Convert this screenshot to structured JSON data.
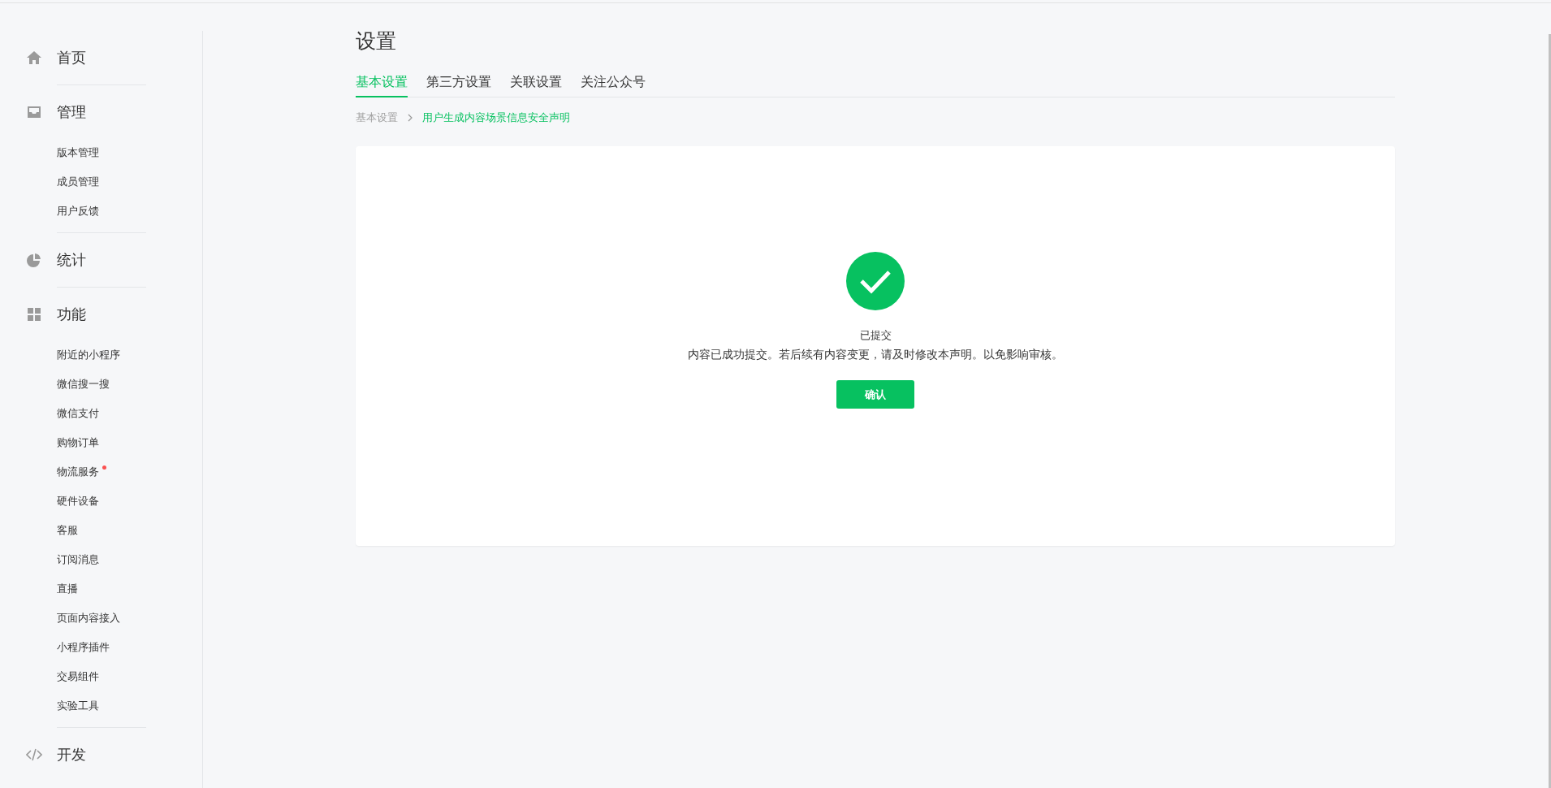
{
  "sidebar": {
    "groups": [
      {
        "label": "首页"
      },
      {
        "label": "管理",
        "items": [
          {
            "label": "版本管理",
            "dot": false
          },
          {
            "label": "成员管理",
            "dot": false
          },
          {
            "label": "用户反馈",
            "dot": false
          }
        ]
      },
      {
        "label": "统计"
      },
      {
        "label": "功能",
        "items": [
          {
            "label": "附近的小程序",
            "dot": false
          },
          {
            "label": "微信搜一搜",
            "dot": false
          },
          {
            "label": "微信支付",
            "dot": false
          },
          {
            "label": "购物订单",
            "dot": false
          },
          {
            "label": "物流服务",
            "dot": true
          },
          {
            "label": "硬件设备",
            "dot": false
          },
          {
            "label": "客服",
            "dot": false
          },
          {
            "label": "订阅消息",
            "dot": false
          },
          {
            "label": "直播",
            "dot": false
          },
          {
            "label": "页面内容接入",
            "dot": false
          },
          {
            "label": "小程序插件",
            "dot": false
          },
          {
            "label": "交易组件",
            "dot": false
          },
          {
            "label": "实验工具",
            "dot": false
          }
        ]
      },
      {
        "label": "开发"
      }
    ]
  },
  "page": {
    "title": "设置",
    "tabs": [
      {
        "label": "基本设置",
        "selected": true
      },
      {
        "label": "第三方设置",
        "selected": false
      },
      {
        "label": "关联设置",
        "selected": false
      },
      {
        "label": "关注公众号",
        "selected": false
      }
    ],
    "breadcrumb": [
      {
        "label": "基本设置",
        "current": false
      },
      {
        "label": "用户生成内容场景信息安全声明",
        "current": true
      }
    ],
    "result": {
      "title": "已提交",
      "message": "内容已成功提交。若后续有内容变更，请及时修改本声明。以免影响审核。",
      "button": "确认"
    }
  }
}
